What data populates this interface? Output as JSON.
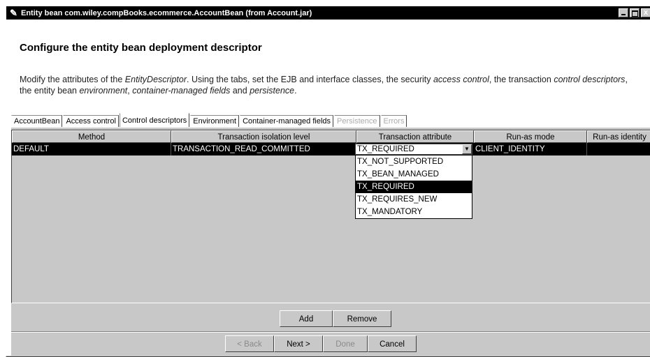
{
  "window": {
    "title": "Entity bean com.wiley.compBooks.ecommerce.AccountBean (from Account.jar)",
    "close_glyph": "x"
  },
  "page": {
    "heading": "Configure the entity bean deployment descriptor",
    "description_parts": [
      "Modify the attributes of the ",
      "EntityDescriptor",
      ". Using the tabs, set the EJB and interface classes, the security ",
      "access control",
      ", the transaction ",
      "control descriptors",
      ", the entity bean ",
      "environment",
      ", ",
      "container-managed fields",
      " and ",
      "persistence",
      "."
    ]
  },
  "tabs": [
    {
      "label": "AccountBean",
      "state": "normal"
    },
    {
      "label": "Access control",
      "state": "normal"
    },
    {
      "label": "Control descriptors",
      "state": "selected"
    },
    {
      "label": "Environment",
      "state": "normal"
    },
    {
      "label": "Container-managed fields",
      "state": "normal"
    },
    {
      "label": "Persistence",
      "state": "disabled"
    },
    {
      "label": "Errors",
      "state": "disabled"
    }
  ],
  "table": {
    "columns": [
      "Method",
      "Transaction isolation level",
      "Transaction attribute",
      "Run-as mode",
      "Run-as identity"
    ],
    "rows": [
      [
        "DEFAULT",
        "TRANSACTION_READ_COMMITTED",
        "TX_REQUIRED",
        "CLIENT_IDENTITY",
        ""
      ]
    ],
    "combo_value": "TX_REQUIRED",
    "dropdown_options": [
      "TX_NOT_SUPPORTED",
      "TX_BEAN_MANAGED",
      "TX_REQUIRED",
      "TX_REQUIRES_NEW",
      "TX_MANDATORY"
    ],
    "dropdown_selected": "TX_REQUIRED"
  },
  "table_buttons": {
    "add": "Add",
    "remove": "Remove"
  },
  "wizard_buttons": {
    "back": "< Back",
    "next": "Next >",
    "done": "Done",
    "cancel": "Cancel"
  },
  "colors": {
    "selection": "#000000",
    "panel": "#c8c8c8"
  }
}
